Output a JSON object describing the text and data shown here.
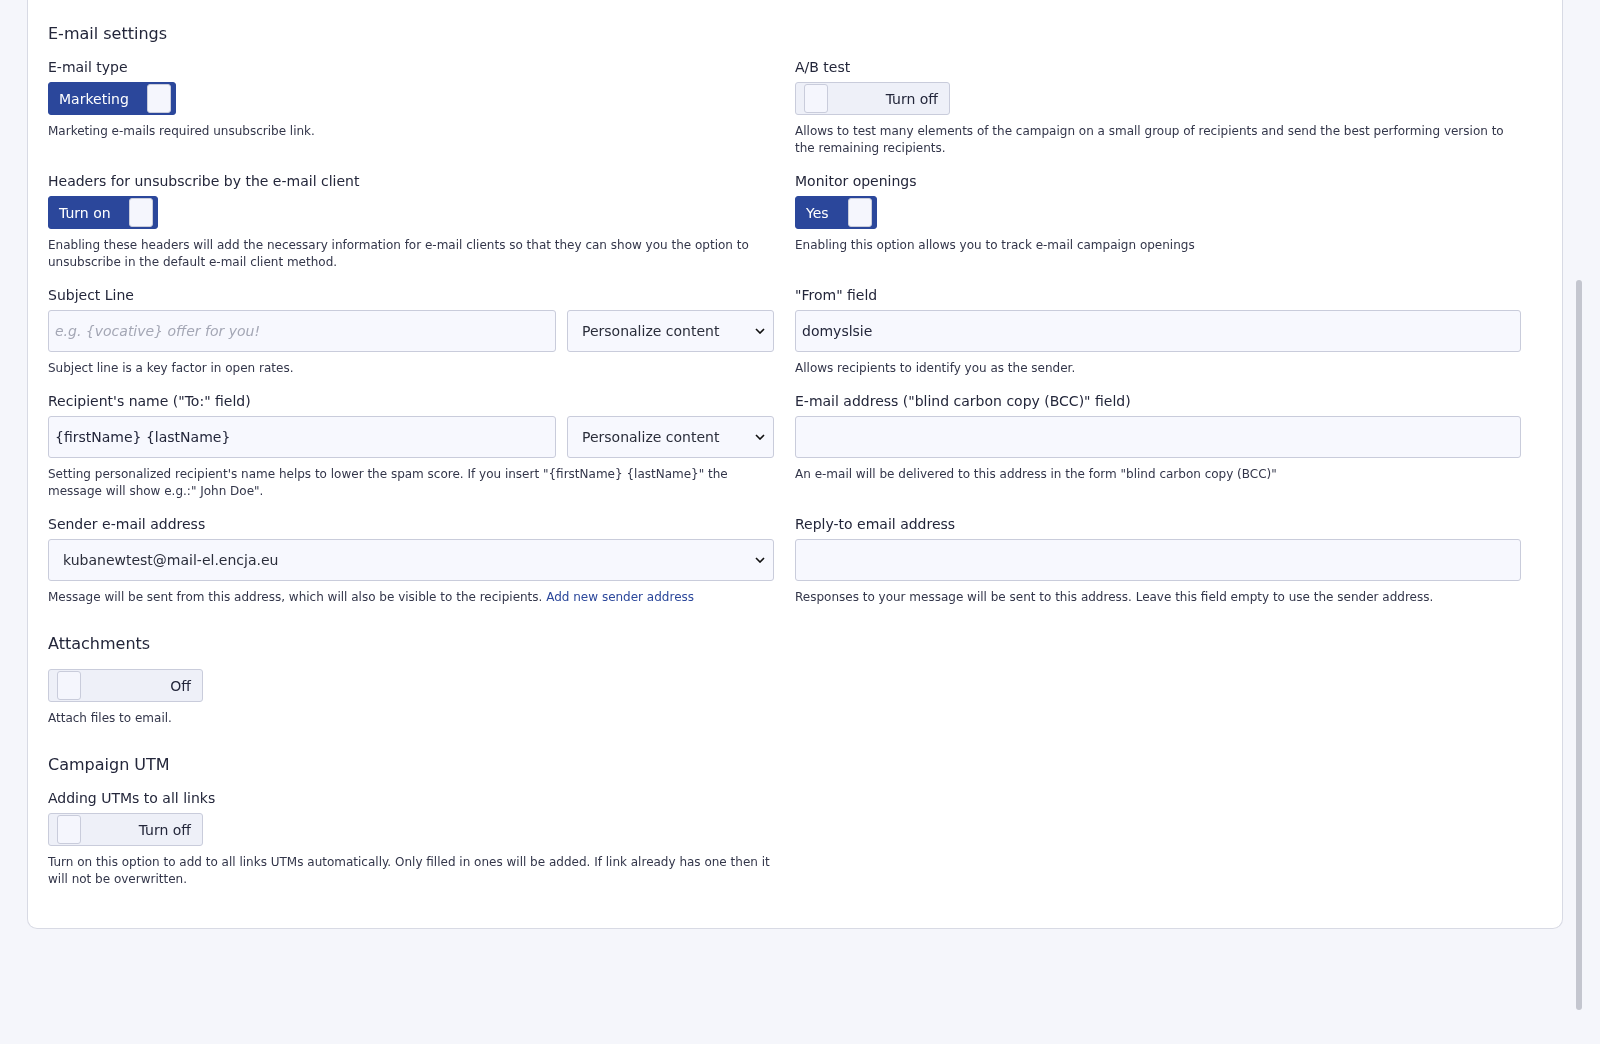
{
  "sections": [
    {
      "title": "E-mail settings",
      "fields": [
        {
          "kind": "toggle",
          "label": "E-mail type",
          "on": true,
          "text": "Marketing",
          "help": "Marketing e-mails required unsubscribe link."
        },
        {
          "kind": "toggle",
          "label": "A/B test",
          "on": false,
          "text": "Turn off",
          "help": "Allows to test many elements of the campaign on a small group of recipients and send the best performing version to the remaining recipients."
        },
        {
          "kind": "toggle",
          "label": "Headers for unsubscribe by the e-mail client",
          "on": true,
          "text": "Turn on",
          "help": "Enabling these headers will add the necessary information for e-mail clients so that they can show you the option to unsubscribe in the default e-mail client method."
        },
        {
          "kind": "toggle",
          "label": "Monitor openings",
          "on": true,
          "text": "Yes",
          "help": "Enabling this option allows you to track e-mail campaign openings"
        },
        {
          "kind": "input_select",
          "label": "Subject Line",
          "placeholder": "e.g. {vocative} offer for you!",
          "select": "Personalize content",
          "help": "Subject line is a key factor in open rates."
        },
        {
          "kind": "input",
          "label": "\"From\" field",
          "value": "domyslsie",
          "help": "Allows recipients to identify you as the sender."
        },
        {
          "kind": "input_select",
          "label": "Recipient's name (\"To:\" field)",
          "value": "{firstName} {lastName}",
          "select": "Personalize content",
          "help": "Setting personalized recipient's name helps to lower the spam score. If you insert \"{firstName} {lastName}\" the message will show e.g.:\" John Doe\"."
        },
        {
          "kind": "input",
          "label": "E-mail address (\"blind carbon copy (BCC)\" field)",
          "help": "An e-mail will be delivered to this address in the form \"blind carbon copy (BCC)\""
        },
        {
          "kind": "select",
          "label": "Sender e-mail address",
          "select": "kubanewtest@mail-el.encja.eu",
          "help": "Message will be sent from this address, which will also be visible to the recipients.",
          "help_link": "Add new sender address"
        },
        {
          "kind": "input",
          "label": "Reply-to email address",
          "help": "Responses to your message will be sent to this address. Leave this field empty to use the sender address."
        }
      ]
    },
    {
      "title": "Attachments",
      "fields": [
        {
          "kind": "toggle",
          "on": false,
          "text": "Off",
          "help": "Attach files to email."
        }
      ]
    },
    {
      "title": "Campaign UTM",
      "fields": [
        {
          "kind": "toggle",
          "label": "Adding UTMs to all links",
          "on": false,
          "text": "Turn off",
          "help": "Turn on this option to add to all links UTMs automatically. Only filled in ones will be added. If link already has one then it will not be overwritten."
        }
      ]
    }
  ]
}
